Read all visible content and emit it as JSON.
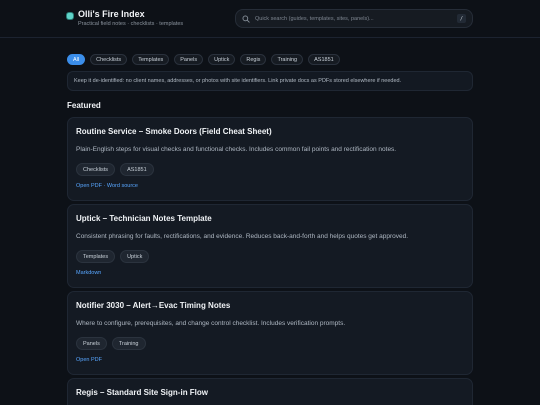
{
  "header": {
    "title": "Olli's Fire Index",
    "subtitle": "Practical field notes · checklists · templates",
    "search_placeholder": "Quick search (guides, templates, sites, panels)...",
    "search_shortcut": "/",
    "brand_color": "#5fd3c8"
  },
  "filters": [
    {
      "label": "All",
      "active": true
    },
    {
      "label": "Checklists",
      "active": false
    },
    {
      "label": "Templates",
      "active": false
    },
    {
      "label": "Panels",
      "active": false
    },
    {
      "label": "Uptick",
      "active": false
    },
    {
      "label": "Regis",
      "active": false
    },
    {
      "label": "Training",
      "active": false
    },
    {
      "label": "AS1851",
      "active": false
    }
  ],
  "notice": "Keep it de-identified: no client names, addresses, or photos with site identifiers. Link private docs as PDFs stored elsewhere if needed.",
  "featured": {
    "title": "Featured",
    "cards": [
      {
        "title": "Routine Service – Smoke Doors (Field Cheat Sheet)",
        "description": "Plain-English steps for visual checks and functional checks. Includes common fail points and rectification notes.",
        "tags": [
          "Checklists",
          "AS1851"
        ],
        "links": [
          "Open PDF",
          "Word source"
        ]
      },
      {
        "title": "Uptick – Technician Notes Template",
        "description": "Consistent phrasing for faults, rectifications, and evidence. Reduces back-and-forth and helps quotes get approved.",
        "tags": [
          "Templates",
          "Uptick"
        ],
        "links": [
          "Markdown"
        ]
      },
      {
        "title": "Notifier 3030 – Alert→Evac Timing Notes",
        "description": "Where to configure, prerequisites, and change control checklist. Includes verification prompts.",
        "tags": [
          "Panels",
          "Training"
        ],
        "links": [
          "Open PDF"
        ]
      },
      {
        "title": "Regis – Standard Site Sign-in Flow",
        "description": "",
        "tags": [],
        "links": []
      }
    ]
  },
  "colors": {
    "accent": "#3b8eea",
    "link": "#58a6ff",
    "background": "#0d1117"
  }
}
